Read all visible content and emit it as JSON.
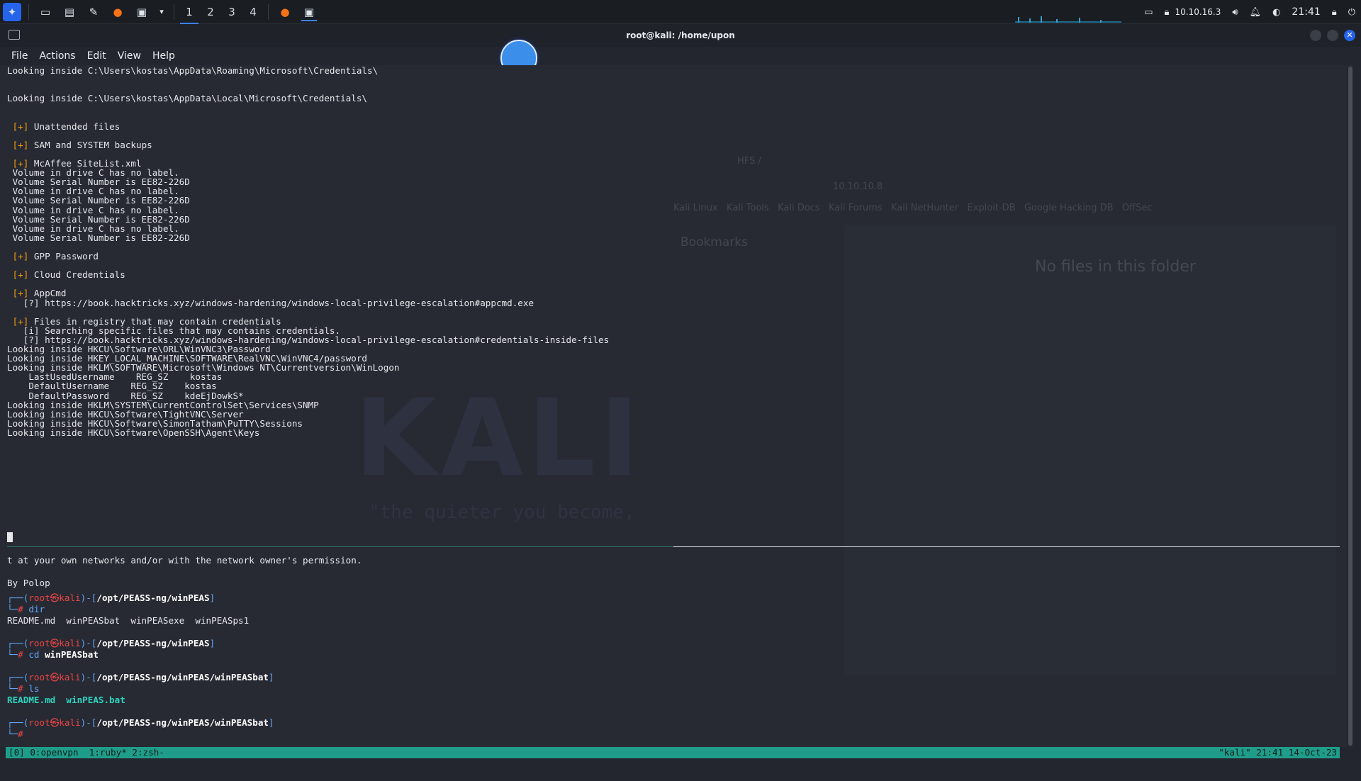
{
  "taskbar": {
    "workspaces": [
      "1",
      "2",
      "3",
      "4"
    ],
    "ip": "10.10.16.3",
    "clock": "21:41"
  },
  "window": {
    "title": "root@kali: /home/upon"
  },
  "menubar": {
    "file": "File",
    "actions": "Actions",
    "edit": "Edit",
    "view": "View",
    "help": "Help"
  },
  "background": {
    "kali_logo": "KALI",
    "quote": "\"the quieter you become,",
    "ghost_tab": "HFS /",
    "ghost_url": "10.10.10.8",
    "ghost_bookmarks": "Kali Linux   Kali Tools   Kali Docs   Kali Forums   Kali NetHunter   Exploit-DB   Google Hacking DB   OffSec",
    "ghost_panel_title": "Bookmarks",
    "ghost_empty": "No files in this folder"
  },
  "terminal": {
    "lines": [
      {
        "t": "Looking inside C:\\Users\\kostas\\AppData\\Roaming\\Microsoft\\Credentials\\"
      },
      {
        "t": ""
      },
      {
        "t": ""
      },
      {
        "t": "Looking inside C:\\Users\\kostas\\AppData\\Local\\Microsoft\\Credentials\\"
      },
      {
        "t": ""
      },
      {
        "t": ""
      },
      {
        "p": " [+]",
        "t": " Unattended files"
      },
      {
        "t": ""
      },
      {
        "p": " [+]",
        "t": " SAM and SYSTEM backups"
      },
      {
        "t": ""
      },
      {
        "p": " [+]",
        "t": " McAffee SiteList.xml"
      },
      {
        "t": " Volume in drive C has no label."
      },
      {
        "t": " Volume Serial Number is EE82-226D"
      },
      {
        "t": " Volume in drive C has no label."
      },
      {
        "t": " Volume Serial Number is EE82-226D"
      },
      {
        "t": " Volume in drive C has no label."
      },
      {
        "t": " Volume Serial Number is EE82-226D"
      },
      {
        "t": " Volume in drive C has no label."
      },
      {
        "t": " Volume Serial Number is EE82-226D"
      },
      {
        "t": ""
      },
      {
        "p": " [+]",
        "t": " GPP Password"
      },
      {
        "t": ""
      },
      {
        "p": " [+]",
        "t": " Cloud Credentials"
      },
      {
        "t": ""
      },
      {
        "p": " [+]",
        "t": " AppCmd"
      },
      {
        "t": "   [?] https://book.hacktricks.xyz/windows-hardening/windows-local-privilege-escalation#appcmd.exe"
      },
      {
        "t": ""
      },
      {
        "p": " [+]",
        "t": " Files in registry that may contain credentials"
      },
      {
        "t": "   [i] Searching specific files that may contains credentials."
      },
      {
        "t": "   [?] https://book.hacktricks.xyz/windows-hardening/windows-local-privilege-escalation#credentials-inside-files"
      },
      {
        "t": "Looking inside HKCU\\Software\\ORL\\WinVNC3\\Password"
      },
      {
        "t": "Looking inside HKEY_LOCAL_MACHINE\\SOFTWARE\\RealVNC\\WinVNC4/password"
      },
      {
        "t": "Looking inside HKLM\\SOFTWARE\\Microsoft\\Windows NT\\Currentversion\\WinLogon"
      },
      {
        "t": "    LastUsedUsername    REG_SZ    kostas"
      },
      {
        "t": "    DefaultUsername    REG_SZ    kostas"
      },
      {
        "t": "    DefaultPassword    REG_SZ    kdeEjDowkS*"
      },
      {
        "t": "Looking inside HKLM\\SYSTEM\\CurrentControlSet\\Services\\SNMP"
      },
      {
        "t": "Looking inside HKCU\\Software\\TightVNC\\Server"
      },
      {
        "t": "Looking inside HKCU\\Software\\SimonTatham\\PuTTY\\Sessions"
      },
      {
        "t": "Looking inside HKCU\\Software\\OpenSSH\\Agent\\Keys"
      }
    ],
    "lower_lines": [
      {
        "t": "t at your own networks and/or with the network owner's permission."
      },
      {
        "t": ""
      },
      {
        "t": "By Polop"
      }
    ],
    "prompts": [
      {
        "user": "root",
        "host": "kali",
        "path": "/opt/PEASS-ng/winPEAS",
        "cmd": "dir",
        "out": "README.md  winPEASbat  winPEASexe  winPEASps1",
        "out_teal": false
      },
      {
        "user": "root",
        "host": "kali",
        "path": "/opt/PEASS-ng/winPEAS",
        "cmd": "cd",
        "arg": "winPEASbat",
        "out": "",
        "out_teal": false
      },
      {
        "user": "root",
        "host": "kali",
        "path": "/opt/PEASS-ng/winPEAS/winPEASbat",
        "cmd": "ls",
        "out": "README.md  winPEAS.bat",
        "out_teal": true
      },
      {
        "user": "root",
        "host": "kali",
        "path": "/opt/PEASS-ng/winPEAS/winPEASbat",
        "cmd": "",
        "out": "",
        "out_teal": false
      }
    ]
  },
  "tmux": {
    "left": "[0] 0:openvpn  1:ruby* 2:zsh-",
    "right": "\"kali\" 21:41 14-Oct-23"
  },
  "colors": {
    "accent": "#3b82f6",
    "tmux_bar": "#1f9d8a",
    "prompt_red": "#ef4444",
    "prompt_blue": "#60a5fa",
    "plus_orange": "#f59e0b"
  }
}
